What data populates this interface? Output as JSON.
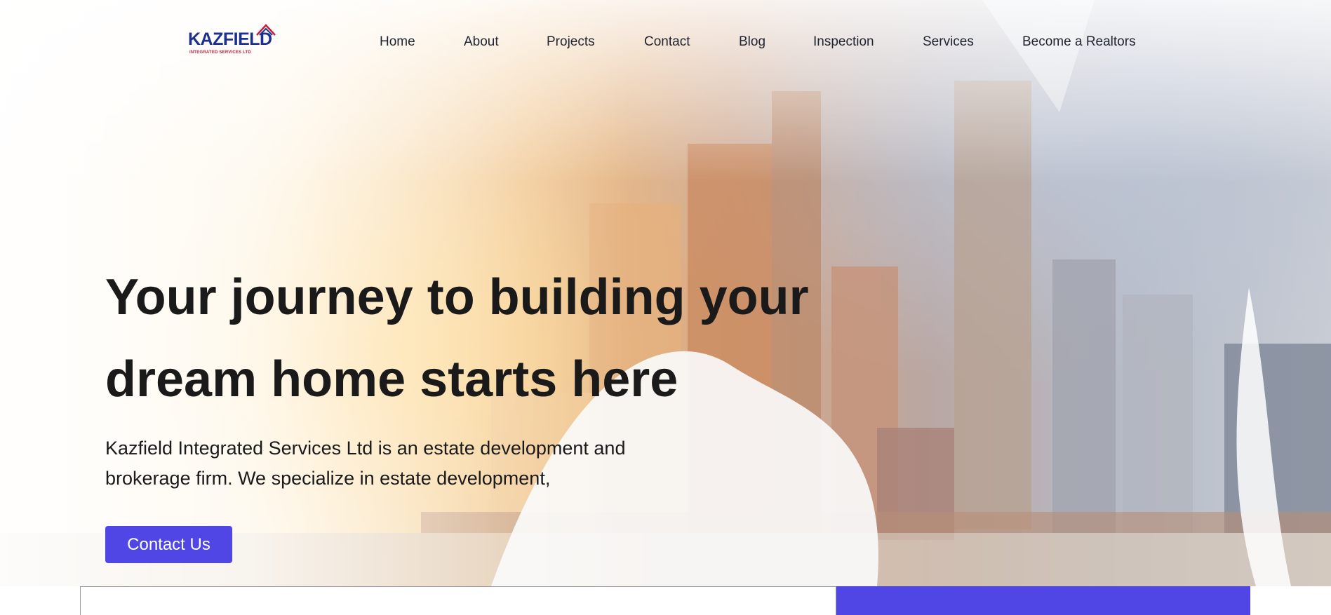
{
  "logo": {
    "name": "KAZFIELD",
    "tagline": "INTEGRATED SERVICES LTD"
  },
  "nav": {
    "items": [
      {
        "label": "Home"
      },
      {
        "label": "About"
      },
      {
        "label": "Projects"
      },
      {
        "label": "Contact"
      },
      {
        "label": "Blog"
      },
      {
        "label": "Inspection"
      },
      {
        "label": "Services"
      },
      {
        "label": "Become a Realtors"
      }
    ]
  },
  "hero": {
    "title": "Your journey to building your dream home starts here",
    "description": "Kazfield Integrated Services Ltd is an estate development and brokerage firm. We specialize in estate development,",
    "cta_label": "Contact Us"
  },
  "colors": {
    "accent": "#4f46e5",
    "logo_blue": "#1d2f8f",
    "logo_red": "#c21f3a",
    "text": "#1a1a1a"
  },
  "icons": {
    "logo": "kazfield-logo-icon"
  }
}
